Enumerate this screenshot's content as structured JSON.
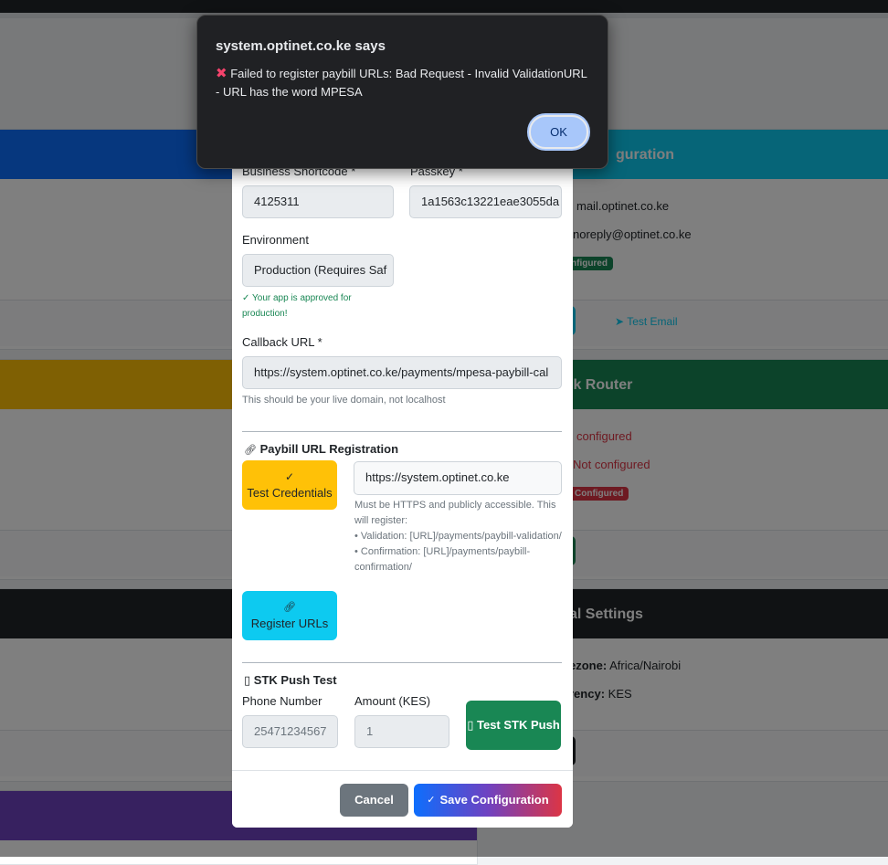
{
  "background": {
    "email_card": {
      "title": "Email Configuration",
      "visible_title": "guration",
      "line1": "mail.optinet.co.ke",
      "line2": "noreply@optinet.co.ke",
      "badge": "nfigured",
      "btn": "e",
      "test_link": "Test Email"
    },
    "router_card": {
      "visible_title": "ik Router",
      "line1": "configured",
      "line2": "Not configured",
      "badge": "Configured",
      "btn": "e"
    },
    "general_card": {
      "visible_title": "al Settings",
      "timezone_label": "ezone:",
      "timezone_value": "Africa/Nairobi",
      "currency_label": "rency:",
      "currency_value": "KES",
      "btn": "e"
    },
    "colors": {
      "blue": "#0d6efd",
      "cyan": "#0dcaf0",
      "yellow": "#ffc107",
      "green": "#198754",
      "dark": "#212529",
      "purple": "#6f42c1",
      "red": "#dc3545"
    }
  },
  "modal": {
    "shortcode_label": "Business Shortcode *",
    "shortcode_value": "4125311",
    "passkey_label": "Passkey *",
    "passkey_value": "1a1563c13221eae3055da",
    "env_label": "Environment",
    "env_value": "Production (Requires Saf",
    "env_hint": "Your app is approved for production!",
    "callback_label": "Callback URL *",
    "callback_value": "https://system.optinet.co.ke/payments/mpesa-paybill-cal",
    "callback_hint": "This should be your live domain, not localhost",
    "paybill_section": "Paybill URL Registration",
    "test_credentials": "Test Credentials",
    "domain_value": "https://system.optinet.co.ke",
    "domain_hint_1": "Must be HTTPS and publicly accessible. This will register:",
    "domain_hint_2": "• Validation: [URL]/payments/paybill-validation/",
    "domain_hint_3": "• Confirmation: [URL]/payments/paybill-confirmation/",
    "register_urls": "Register URLs",
    "stk_section": "STK Push Test",
    "phone_label": "Phone Number",
    "phone_value": "25471234567",
    "amount_label": "Amount (KES)",
    "amount_value": "1",
    "test_stk": "Test STK Push",
    "cancel": "Cancel",
    "save": "Save Configuration"
  },
  "alert": {
    "title": "system.optinet.co.ke says",
    "icon": "cross-mark-icon",
    "message": "Failed to register paybill URLs: Bad Request - Invalid ValidationURL - URL has the word MPESA",
    "ok": "OK"
  }
}
